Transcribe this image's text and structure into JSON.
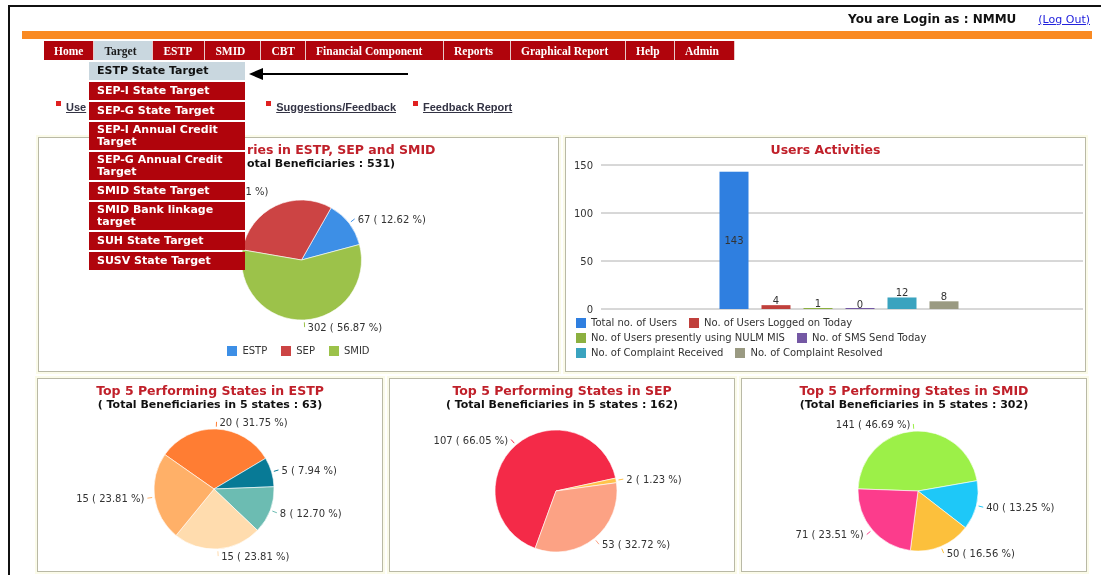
{
  "user": {
    "login_label": "You are Login as : NMMU",
    "logout": "(Log Out)"
  },
  "menu": [
    {
      "label": "Home",
      "selected": false
    },
    {
      "label": "Target",
      "selected": true
    },
    {
      "label": "ESTP",
      "selected": false
    },
    {
      "label": "SMID",
      "selected": false
    },
    {
      "label": "CBT",
      "selected": false
    },
    {
      "label": "Financial Component",
      "selected": false
    },
    {
      "label": "Reports",
      "selected": false
    },
    {
      "label": "Graphical Report",
      "selected": false
    },
    {
      "label": "Help",
      "selected": false
    },
    {
      "label": "Admin",
      "selected": false
    }
  ],
  "dropdown": [
    {
      "label": "ESTP State Target",
      "selected": true
    },
    {
      "label": "SEP-I State Target",
      "selected": false
    },
    {
      "label": "SEP-G State Target",
      "selected": false
    },
    {
      "label": "SEP-I Annual Credit Target",
      "selected": false
    },
    {
      "label": "SEP-G Annual Credit Target",
      "selected": false
    },
    {
      "label": "SMID State Target",
      "selected": false
    },
    {
      "label": "SMID Bank linkage target",
      "selected": false
    },
    {
      "label": "SUH State Target",
      "selected": false
    },
    {
      "label": "SUSV State Target",
      "selected": false
    }
  ],
  "links": [
    "Use",
    "Suggestions/Feedback",
    "Feedback Report"
  ],
  "top_panels": [
    {
      "kind": "pie",
      "title": "ries in ESTP, SEP and SMID",
      "subtitle": "otal Beneficiaries : 531)",
      "chart_data": {
        "type": "pie",
        "categories": [
          "ESTP",
          "SEP",
          "SMID"
        ],
        "values": [
          67,
          162,
          302
        ],
        "colors": [
          "#3d8fe6",
          "#cc4444",
          "#9cc24a"
        ],
        "value_labels": [
          "67 ( 12.62 %)",
          null,
          "302 ( 56.87 %)"
        ]
      },
      "cut_label": "1 %)"
    },
    {
      "kind": "bar",
      "title": "Users Activities",
      "chart_data": {
        "type": "bar",
        "ylim": [
          0,
          150
        ],
        "yticks": [
          0,
          50,
          100,
          150
        ],
        "data_labels": true,
        "series": [
          {
            "name": "Total no. of Users",
            "color": "#2f7fe0",
            "values": [
              143
            ]
          },
          {
            "name": "No. of Users Logged on Today",
            "color": "#c0403c",
            "values": [
              4
            ]
          },
          {
            "name": "No. of Users presently using NULM MIS",
            "color": "#8cb040",
            "values": [
              1
            ]
          },
          {
            "name": "No. of SMS Send Today",
            "color": "#7458a4",
            "values": [
              0
            ]
          },
          {
            "name": "No. of Complaint Received",
            "color": "#3aa3bf",
            "values": [
              12
            ]
          },
          {
            "name": "No. of Complaint Resolved",
            "color": "#9a9a82",
            "values": [
              8
            ]
          }
        ]
      }
    }
  ],
  "bottom_panels": [
    {
      "title": "Top 5 Performing States in ESTP",
      "subtitle": "( Total Beneficiaries in 5 states : 63)",
      "chart_data": {
        "type": "pie",
        "values": [
          20,
          5,
          8,
          15,
          15
        ],
        "colors": [
          "#ff7d33",
          "#087a96",
          "#6cbcb2",
          "#ffdcae",
          "#ffb068"
        ],
        "value_labels": [
          "20 ( 31.75 %)",
          "5 ( 7.94 %)",
          "8 ( 12.70 %)",
          "15 ( 23.81 %)",
          "15 ( 23.81 %)"
        ]
      }
    },
    {
      "title": "Top 5 Performing States in SEP",
      "subtitle": "( Total Beneficiaries in 5 states : 162)",
      "chart_data": {
        "type": "pie",
        "values": [
          107,
          2,
          53
        ],
        "colors": [
          "#f42a48",
          "#ffc24a",
          "#fca284"
        ],
        "value_labels": [
          "107 ( 66.05 %)",
          "2 ( 1.23 %)",
          "53 ( 32.72 %)"
        ]
      }
    },
    {
      "title": "Top 5 Performing States in SMID",
      "subtitle": "(Total Beneficiaries in 5 states : 302)",
      "chart_data": {
        "type": "pie",
        "values": [
          141,
          40,
          50,
          71
        ],
        "colors": [
          "#9cf048",
          "#1ec8f8",
          "#fcc03c",
          "#fc3c8c"
        ],
        "value_labels": [
          "141 ( 46.69 %)",
          "40 ( 13.25 %)",
          "50 ( 16.56 %)",
          "71 ( 23.51 %)"
        ]
      }
    }
  ]
}
